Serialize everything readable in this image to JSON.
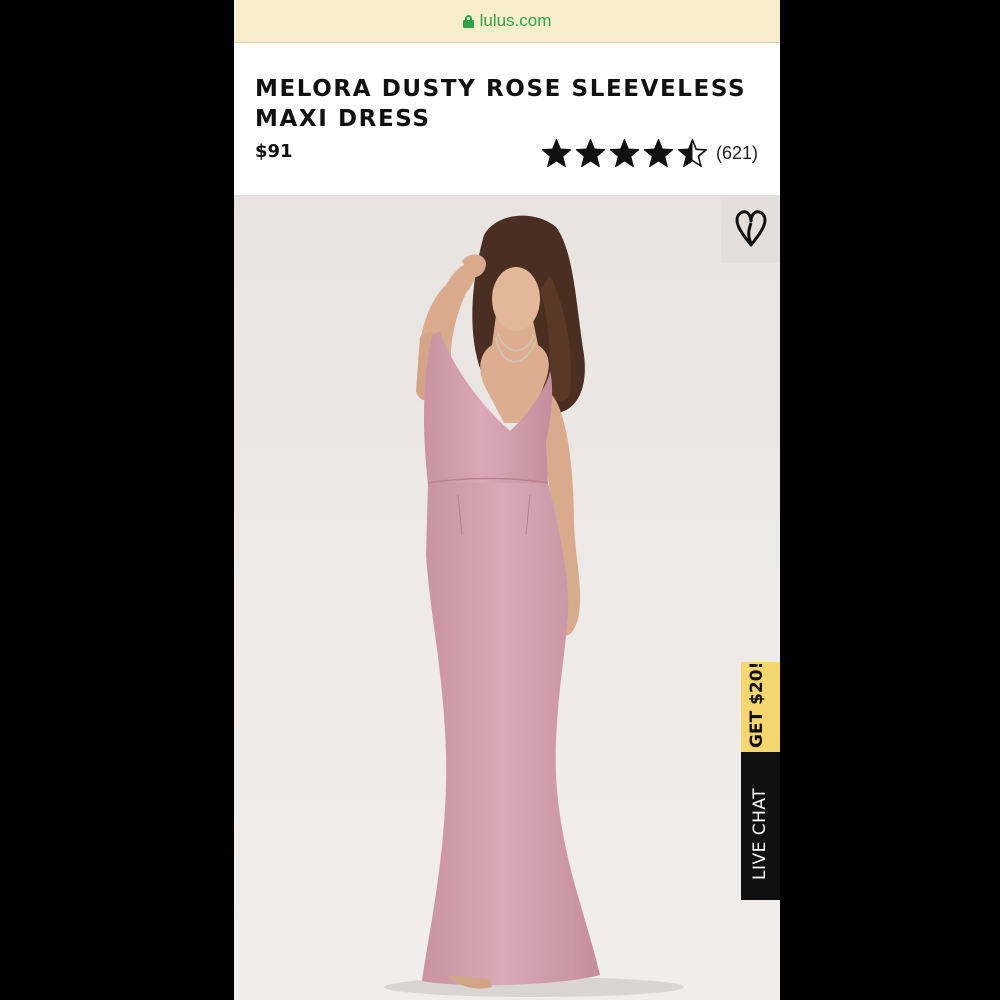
{
  "browser": {
    "url": "lulus.com",
    "lock_icon": "lock-icon"
  },
  "product": {
    "title_line1": "MELORA DUSTY ROSE SLEEVELESS",
    "title_line2": "MAXI DRESS",
    "price": "$91",
    "rating": {
      "value": 4.5,
      "max": 5,
      "count_label": "(621)"
    },
    "image_alt": "Model wearing dusty rose sleeveless maxi dress",
    "dress_color": "#d4a3b6"
  },
  "actions": {
    "wishlist_icon": "heart-icon"
  },
  "promo": {
    "label": "GET $20!"
  },
  "chat": {
    "label": "LIVE CHAT"
  },
  "colors": {
    "url_bar": "#f8eecb",
    "url_text": "#2aa54a",
    "promo_bg": "#f5d76e",
    "chat_bg": "#111111"
  }
}
